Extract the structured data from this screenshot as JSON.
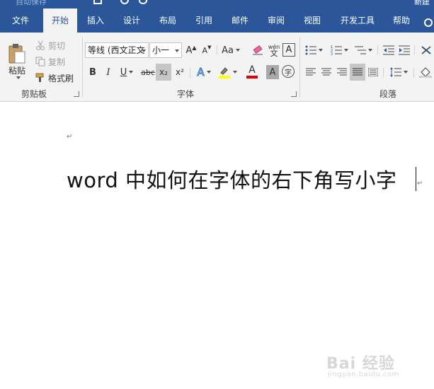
{
  "titlebar": {
    "autosave": "自动保存",
    "doc_name": "新建"
  },
  "tabs": [
    {
      "label": "文件"
    },
    {
      "label": "开始"
    },
    {
      "label": "插入"
    },
    {
      "label": "设计"
    },
    {
      "label": "布局"
    },
    {
      "label": "引用"
    },
    {
      "label": "邮件"
    },
    {
      "label": "审阅"
    },
    {
      "label": "视图"
    },
    {
      "label": "开发工具"
    },
    {
      "label": "帮助"
    }
  ],
  "active_tab": "开始",
  "clipboard": {
    "group_label": "剪贴板",
    "paste": "粘贴",
    "cut": "剪切",
    "copy": "复制",
    "format_painter": "格式刷"
  },
  "font": {
    "group_label": "字体",
    "font_name": "等线 (西文正文",
    "font_size": "小一",
    "grow": "A",
    "shrink": "A",
    "case": "Aa",
    "bold": "B",
    "italic": "I",
    "underline": "U",
    "strikethrough": "abc",
    "subscript": "x₂",
    "superscript": "x²",
    "effects": "A",
    "font_color": "A",
    "char_shading": "A",
    "enclose": "字",
    "phonetic_top": "wén",
    "phonetic_bottom": "文",
    "border": "A"
  },
  "paragraph": {
    "group_label": "段落"
  },
  "document": {
    "text": "word 中如何在字体的右下角写小字",
    "paragraph_mark": "↵"
  },
  "watermark": {
    "text": "Bai 经验",
    "url": "jingyan.baidu.com"
  },
  "colors": {
    "accent": "#2b579a",
    "highlight": "#ffff00",
    "font_color": "#e00000"
  }
}
